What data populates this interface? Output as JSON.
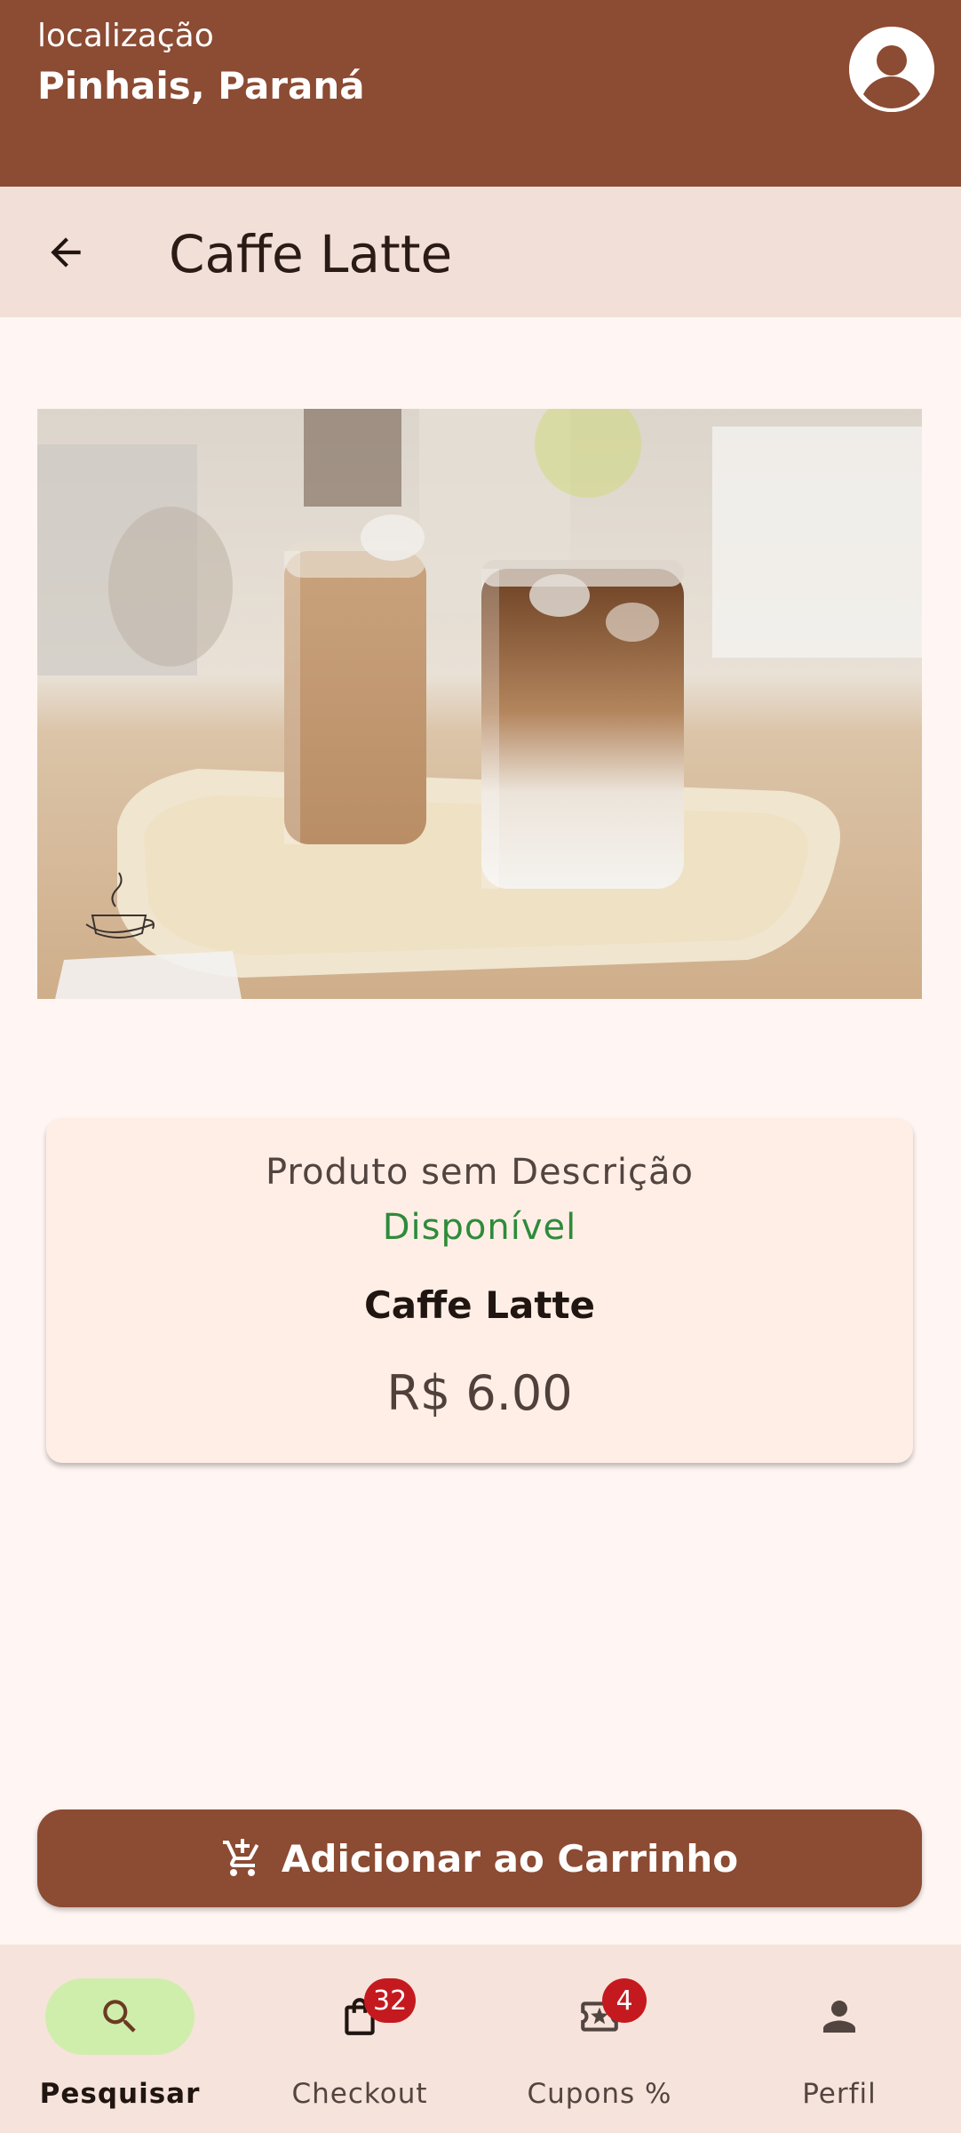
{
  "header": {
    "location_label": "localização",
    "location_value": "Pinhais, Paraná"
  },
  "app_bar": {
    "title": "Caffe Latte"
  },
  "product": {
    "description": "Produto sem Descrição",
    "status": "Disponível",
    "name": "Caffe Latte",
    "price": "R$ 6.00"
  },
  "actions": {
    "add_to_cart": "Adicionar ao Carrinho"
  },
  "bottom_nav": {
    "items": [
      {
        "label": "Pesquisar",
        "icon": "search-icon",
        "active": true
      },
      {
        "label": "Checkout",
        "icon": "shopping-bag-icon",
        "badge": "32"
      },
      {
        "label": "Cupons %",
        "icon": "coupon-icon",
        "badge": "4"
      },
      {
        "label": "Perfil",
        "icon": "person-icon"
      }
    ]
  },
  "colors": {
    "brand": "#8c4b33",
    "app_bar": "#f2dfd7",
    "available": "#2e8b3a",
    "badge": "#c41a1f",
    "nav_active": "#cfeeac"
  }
}
